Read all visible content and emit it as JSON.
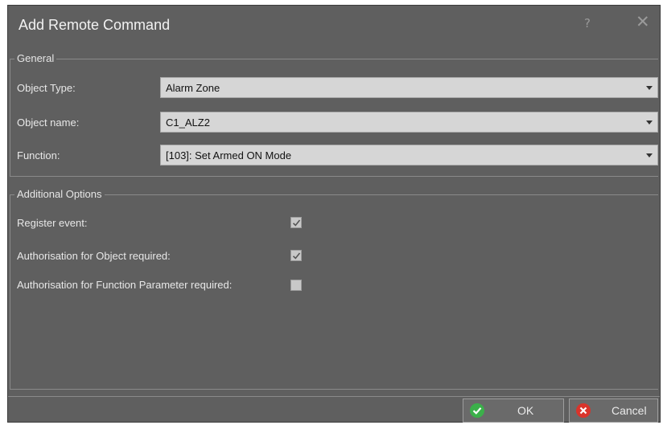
{
  "window": {
    "title": "Add Remote Command",
    "help_glyph": "?",
    "close_glyph": "✕"
  },
  "general": {
    "legend": "General",
    "object_type": {
      "label": "Object Type:",
      "value": "Alarm Zone"
    },
    "object_name": {
      "label": "Object name:",
      "value": "C1_ALZ2"
    },
    "function": {
      "label": "Function:",
      "value": "[103]: Set Armed ON Mode"
    }
  },
  "additional": {
    "legend": "Additional Options",
    "register_event": {
      "label": "Register event:",
      "checked": true
    },
    "auth_object": {
      "label": "Authorisation for Object required:",
      "checked": true
    },
    "auth_function": {
      "label": "Authorisation for Function Parameter required:",
      "checked": false
    }
  },
  "buttons": {
    "ok_label": "OK",
    "cancel_label": "Cancel"
  },
  "colors": {
    "ok_icon": "#3bb04a",
    "cancel_icon": "#d9342b",
    "dialog_bg": "#5f5f5f"
  }
}
